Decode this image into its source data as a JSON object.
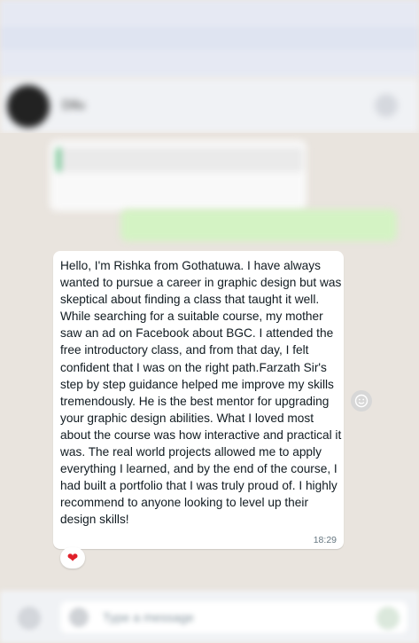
{
  "header": {
    "contact_name": "Dilu"
  },
  "earlier_messages": {
    "incoming_preview": "",
    "outgoing_preview": ""
  },
  "message": {
    "text": "Hello, I'm Rishka from Gothatuwa. I have always wanted to pursue a career in graphic design but was skeptical about finding a class that taught it well. While searching for a suitable course, my mother saw an ad on Facebook about BGC. I attended the free introductory class, and from that day, I felt confident that I was on the right path.Farzath Sir's step by step guidance helped me improve my skills tremendously. He is the best mentor for upgrading your graphic design abilities. What I loved most about the course was how interactive and practical it was. The real world projects allowed me to apply everything I learned, and by the end of the course, I had built a portfolio that I was truly proud of. I highly recommend to anyone looking to level up their design skills!",
    "time": "18:29",
    "reaction": "❤",
    "reaction_icon": "heart-icon"
  },
  "composer": {
    "placeholder": "Type a message"
  },
  "colors": {
    "chat_bg": "#e9e4de",
    "bubble_bg": "#ffffff",
    "outgoing_bg": "#d4f3c4",
    "reaction": "#e0202a"
  }
}
